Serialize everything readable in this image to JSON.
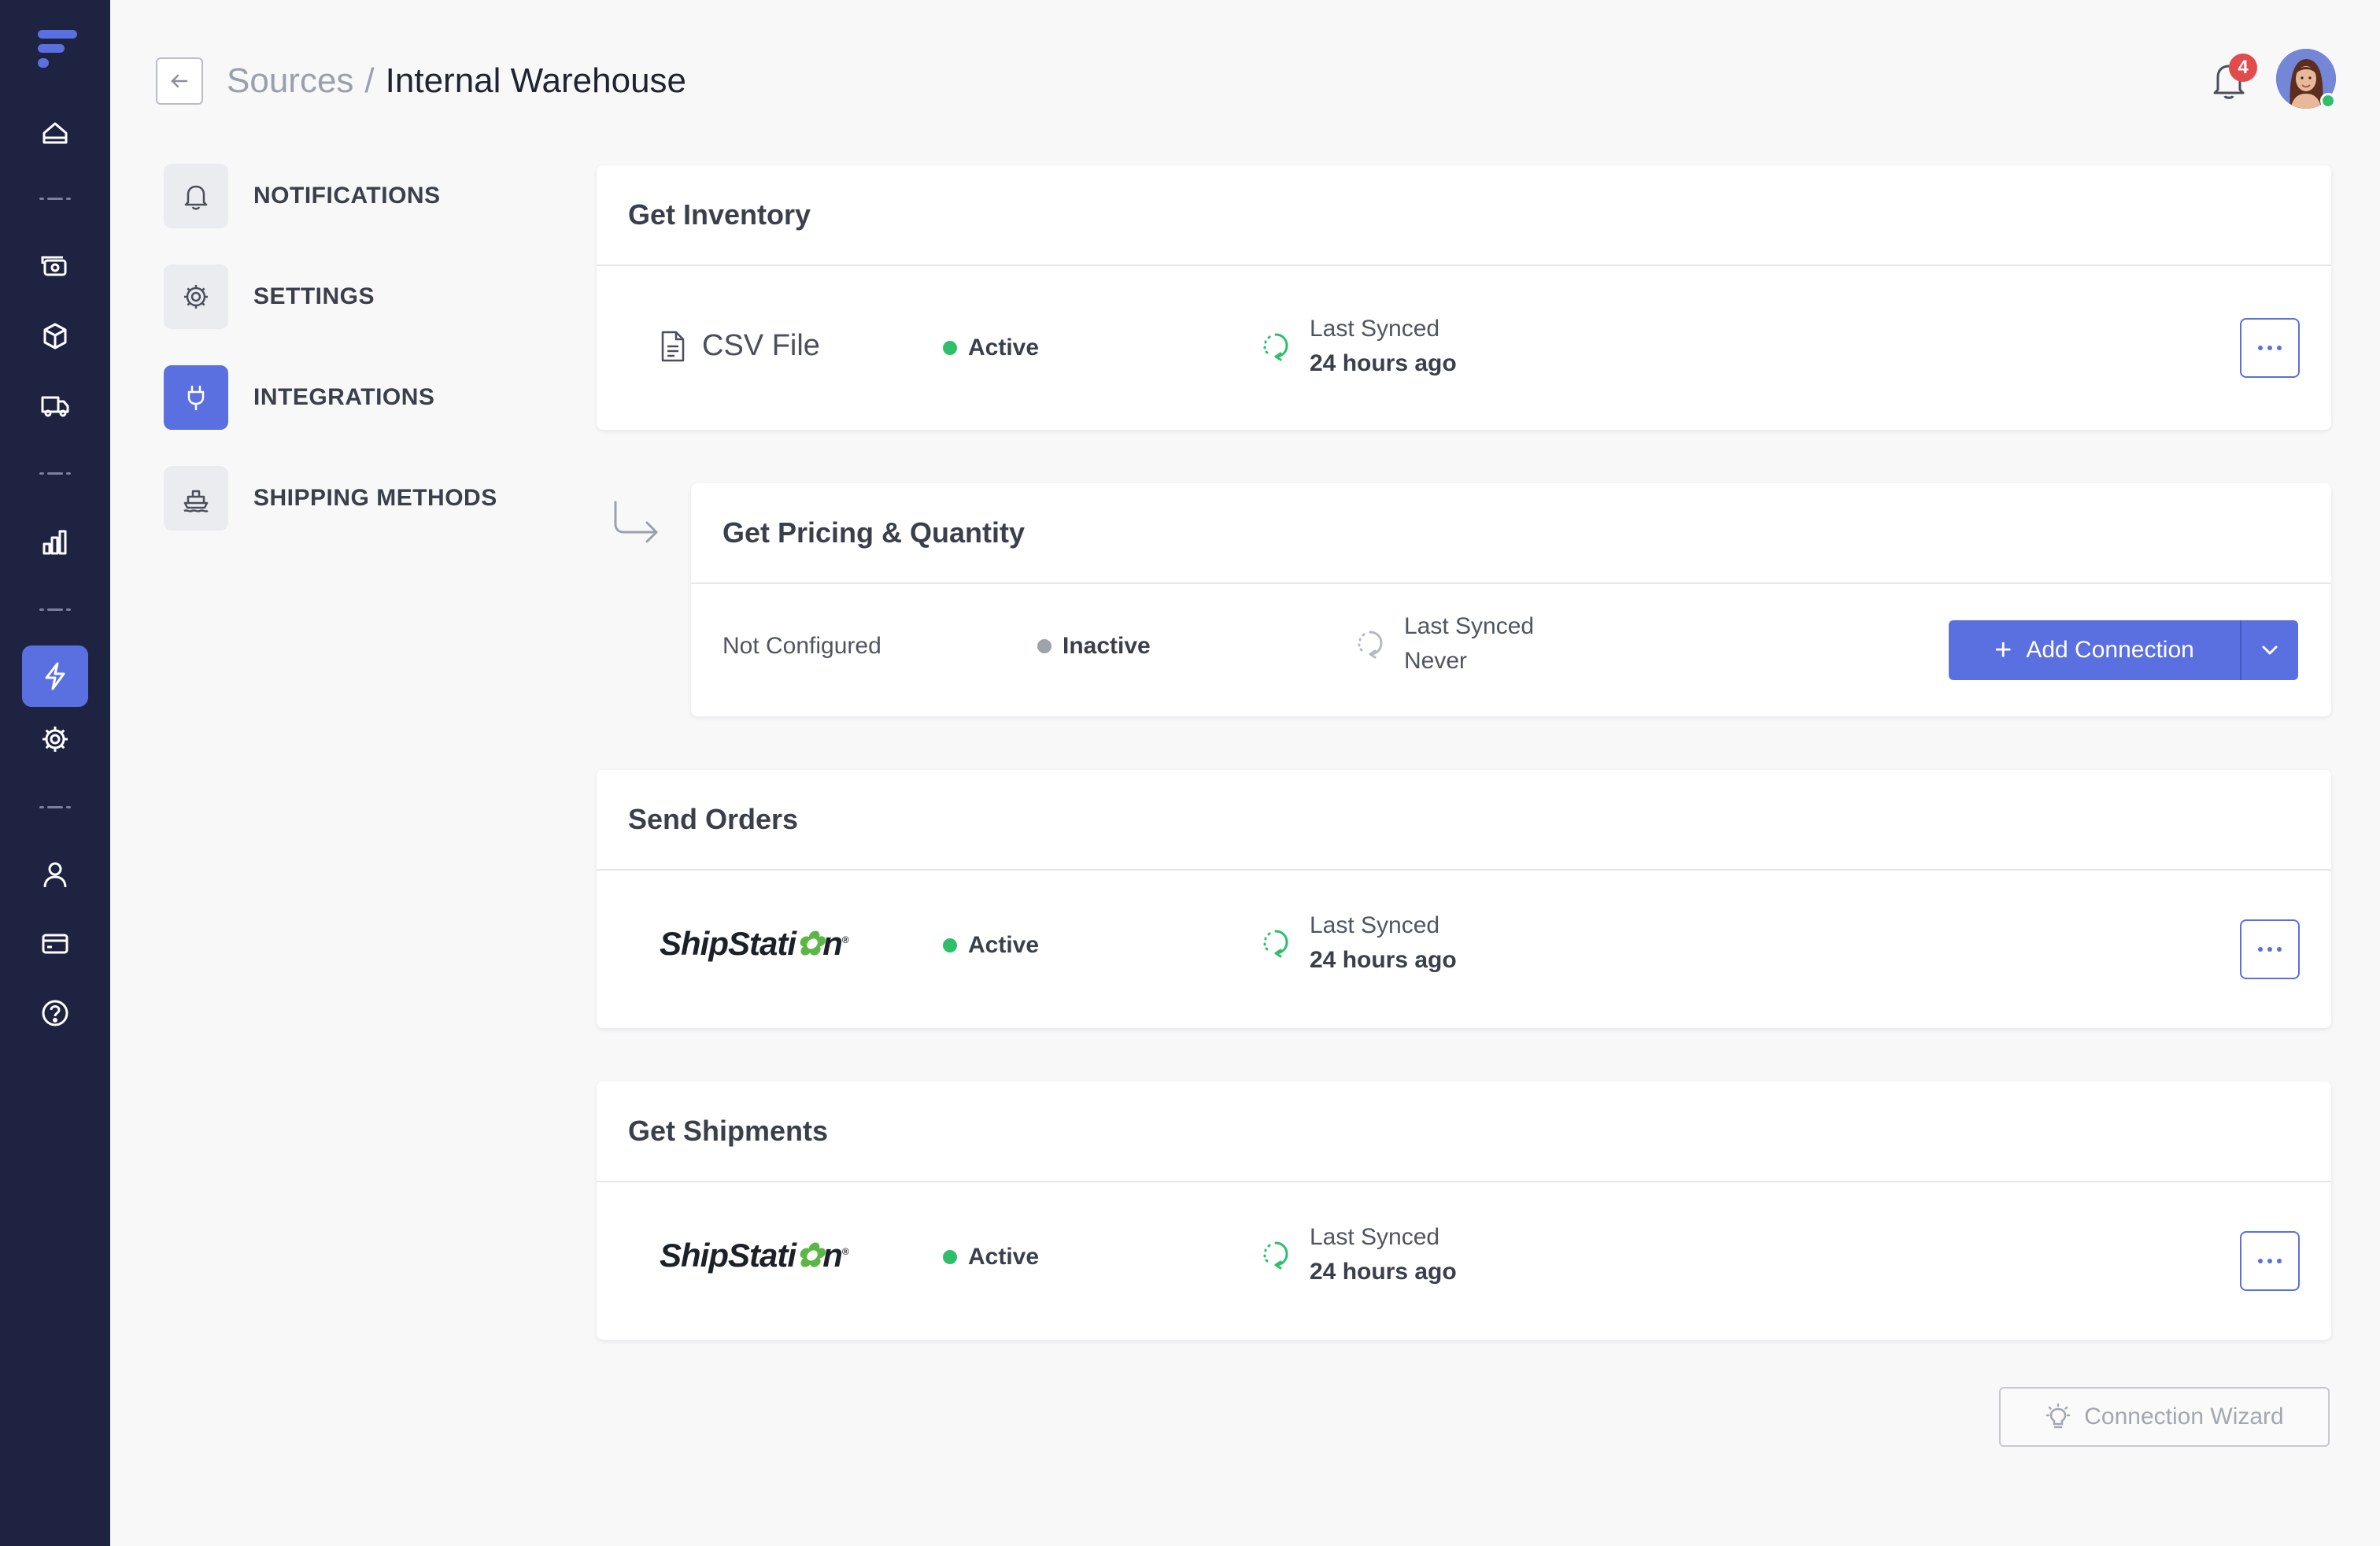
{
  "header": {
    "breadcrumb_parent": "Sources",
    "breadcrumb_separator": "/",
    "breadcrumb_current": "Internal Warehouse",
    "notification_count": "4"
  },
  "settings_menu": [
    {
      "label": "NOTIFICATIONS",
      "icon": "bell-icon",
      "active": false
    },
    {
      "label": "SETTINGS",
      "icon": "gear-icon",
      "active": false
    },
    {
      "label": "INTEGRATIONS",
      "icon": "plug-icon",
      "active": true
    },
    {
      "label": "SHIPPING METHODS",
      "icon": "ship-icon",
      "active": false
    }
  ],
  "sections": {
    "inventory": {
      "title": "Get Inventory",
      "source": "CSV File",
      "status": "Active",
      "sync_label": "Last Synced",
      "sync_value": "24 hours ago"
    },
    "pricing": {
      "title": "Get Pricing & Quantity",
      "source": "Not Configured",
      "status": "Inactive",
      "sync_label": "Last Synced",
      "sync_value": "Never",
      "add_label": "Add Connection"
    },
    "orders": {
      "title": "Send Orders",
      "source_logo_a": "ShipStati",
      "source_logo_b": "n",
      "status": "Active",
      "sync_label": "Last Synced",
      "sync_value": "24 hours ago"
    },
    "shipments": {
      "title": "Get Shipments",
      "source_logo_a": "ShipStati",
      "source_logo_b": "n",
      "status": "Active",
      "sync_label": "Last Synced",
      "sync_value": "24 hours ago"
    }
  },
  "wizard_label": "Connection Wizard",
  "colors": {
    "rail": "#1d2340",
    "accent": "#5a6fe0",
    "active_status": "#2fbf6b",
    "inactive_status": "#9ea2ab",
    "badge": "#e24b4b"
  }
}
